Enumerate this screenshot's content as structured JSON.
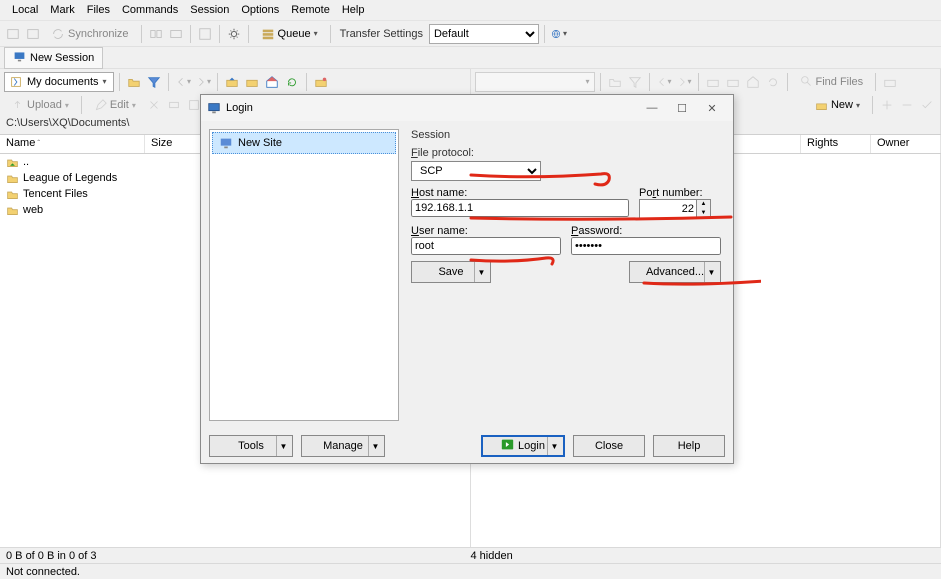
{
  "menu": [
    "Local",
    "Mark",
    "Files",
    "Commands",
    "Session",
    "Options",
    "Remote",
    "Help"
  ],
  "toolbar1": {
    "sync": "Synchronize",
    "queue": "Queue",
    "transfer_settings": "Transfer Settings",
    "transfer_value": "Default"
  },
  "tab": {
    "new_session": "New Session"
  },
  "dualbar": {
    "left_location": "My documents",
    "find_files": "Find Files"
  },
  "actbar": {
    "upload": "Upload",
    "edit": "Edit",
    "new": "New"
  },
  "path": {
    "left": "C:\\Users\\XQ\\Documents\\"
  },
  "cols": {
    "name": "Name",
    "size": "Size",
    "rights": "Rights",
    "owner": "Owner"
  },
  "files": [
    {
      "name": "..",
      "type": "up"
    },
    {
      "name": "League of Legends",
      "type": "folder"
    },
    {
      "name": "Tencent Files",
      "type": "folder"
    },
    {
      "name": "web",
      "type": "folder"
    }
  ],
  "status": {
    "bytes": "0 B of 0 B in 0 of 3",
    "hidden": "4 hidden",
    "conn": "Not connected."
  },
  "dialog": {
    "title": "Login",
    "new_site": "New Site",
    "session_group": "Session",
    "file_protocol_label": "File protocol:",
    "file_protocol_value": "SCP",
    "host_label": "Host name:",
    "host_value": "192.168.1.1",
    "port_label": "Port number:",
    "port_value": "22",
    "user_label": "User name:",
    "user_value": "root",
    "password_label": "Password:",
    "password_value": "•••••••",
    "save": "Save",
    "advanced": "Advanced...",
    "tools": "Tools",
    "manage": "Manage",
    "login": "Login",
    "close": "Close",
    "help": "Help"
  }
}
